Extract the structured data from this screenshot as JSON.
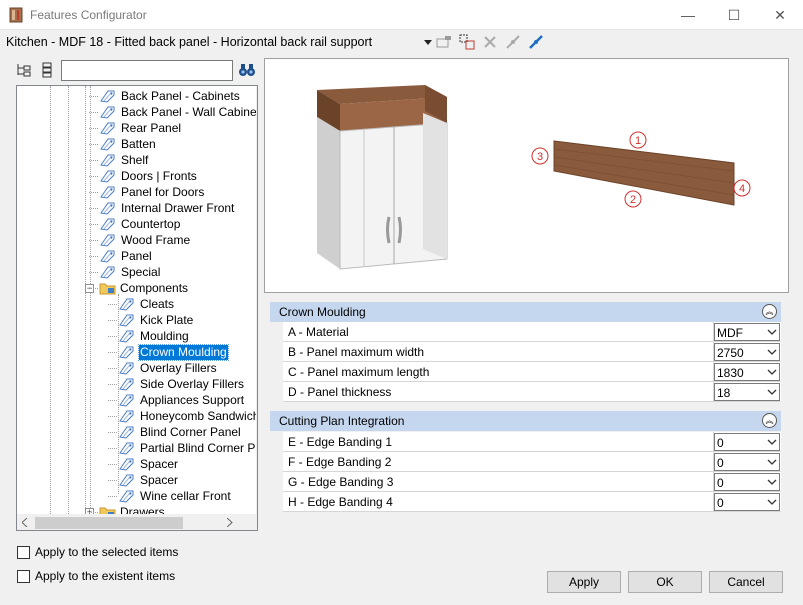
{
  "window": {
    "title": "Features Configurator",
    "minimize_glyph": "—",
    "maximize_glyph": "☐",
    "close_glyph": "✕"
  },
  "toolbar": {
    "path": "Kitchen - MDF 18 - Fitted back panel - Horizontal back rail support"
  },
  "search": {
    "value": "",
    "placeholder": ""
  },
  "tree": {
    "items": [
      {
        "label": "Back Panel - Cabinets"
      },
      {
        "label": "Back Panel - Wall Cabinets"
      },
      {
        "label": "Rear Panel"
      },
      {
        "label": "Batten"
      },
      {
        "label": "Shelf"
      },
      {
        "label": "Doors | Fronts"
      },
      {
        "label": "Panel for Doors"
      },
      {
        "label": "Internal Drawer Front"
      },
      {
        "label": "Countertop"
      },
      {
        "label": "Wood Frame"
      },
      {
        "label": "Panel"
      },
      {
        "label": "Special"
      },
      {
        "label": "Components"
      },
      {
        "label": "Cleats"
      },
      {
        "label": " Kick Plate"
      },
      {
        "label": "Moulding"
      },
      {
        "label": "Crown Moulding"
      },
      {
        "label": " Overlay Fillers"
      },
      {
        "label": "Side Overlay Fillers"
      },
      {
        "label": "Appliances Support"
      },
      {
        "label": "Honeycomb Sandwich"
      },
      {
        "label": "Blind Corner Panel"
      },
      {
        "label": " Partial Blind Corner Panel"
      },
      {
        "label": " Spacer"
      },
      {
        "label": " Spacer"
      },
      {
        "label": "Wine cellar Front"
      },
      {
        "label": "Drawers"
      }
    ],
    "selected": "Crown Moulding"
  },
  "options": {
    "apply_selected": "Apply to the selected items",
    "apply_existent": "Apply to the existent items"
  },
  "preview": {
    "markers": [
      "1",
      "2",
      "3",
      "4"
    ]
  },
  "groups": [
    {
      "title": "Crown Moulding",
      "collapse_glyph": "︽",
      "props": [
        {
          "name": "A - Material",
          "value": "MDF"
        },
        {
          "name": "B - Panel maximum width",
          "value": "2750"
        },
        {
          "name": "C - Panel maximum length",
          "value": "1830"
        },
        {
          "name": "D - Panel thickness",
          "value": "18"
        }
      ]
    },
    {
      "title": "Cutting Plan Integration",
      "collapse_glyph": "︽",
      "props": [
        {
          "name": "E - Edge Banding 1",
          "value": "0"
        },
        {
          "name": "F - Edge Banding 2",
          "value": "0"
        },
        {
          "name": "G - Edge Banding 3",
          "value": "0"
        },
        {
          "name": "H - Edge Banding 4",
          "value": "0"
        }
      ]
    }
  ],
  "buttons": {
    "apply": "Apply",
    "ok": "OK",
    "cancel": "Cancel"
  },
  "colors": {
    "selection": "#0078d7",
    "group_header": "#c5d7ee",
    "wood": "#8b5a3c"
  }
}
